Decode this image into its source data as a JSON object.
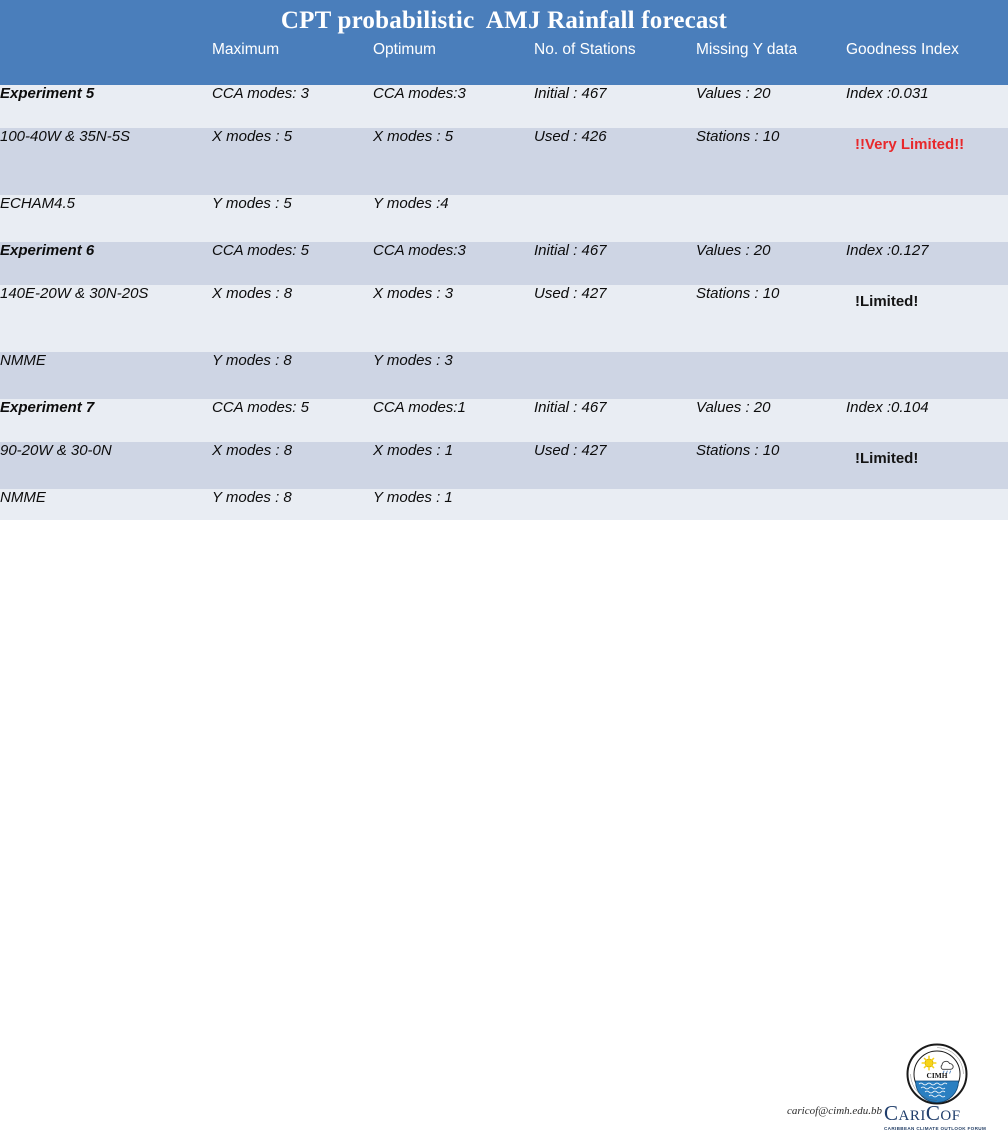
{
  "title": "CPT probabilistic  AMJ Rainfall forecast",
  "columns": [
    {
      "key": "label",
      "label": ""
    },
    {
      "key": "maximum",
      "label": "Maximum"
    },
    {
      "key": "optimum",
      "label": "Optimum"
    },
    {
      "key": "stations",
      "label": "No. of Stations"
    },
    {
      "key": "missing",
      "label": "Missing Y data"
    },
    {
      "key": "goodness",
      "label": "Goodness Index"
    }
  ],
  "blocks": [
    {
      "id": "experiment-5",
      "rows": [
        {
          "label": "Experiment 5",
          "maximum": "CCA modes: 3",
          "optimum": "CCA modes:3",
          "stations": "Initial : 467",
          "missing": "Values : 20"
        },
        {
          "label": "100-40W & 35N-5S",
          "maximum": "X modes : 5",
          "optimum": "X modes : 5",
          "stations": "Used : 426",
          "missing": "Stations : 10"
        },
        {
          "label": "ECHAM4.5",
          "maximum": "Y modes : 5",
          "optimum": "Y modes :4",
          "stations": "",
          "missing": ""
        }
      ],
      "goodness_index": "Index :0.031",
      "goodness_note": "!!Very Limited!!",
      "goodness_note_color": "#e8282b",
      "goodness_note_anchor": "bottom"
    },
    {
      "id": "experiment-6",
      "rows": [
        {
          "label": "Experiment 6",
          "maximum": "CCA modes: 5",
          "optimum": "CCA modes:3",
          "stations": "Initial : 467",
          "missing": "Values : 20"
        },
        {
          "label": "140E-20W & 30N-20S",
          "maximum": "X modes : 8",
          "optimum": "X modes : 3",
          "stations": "Used : 427",
          "missing": "Stations : 10"
        },
        {
          "label": "NMME",
          "maximum": "Y modes : 8",
          "optimum": "Y modes : 3",
          "stations": "",
          "missing": ""
        }
      ],
      "goodness_index": "Index :0.127",
      "goodness_note": "!Limited!",
      "goodness_note_color": "#141414",
      "goodness_note_anchor": "bottom"
    },
    {
      "id": "experiment-7",
      "rows": [
        {
          "label": "Experiment 7",
          "maximum": "CCA modes: 5",
          "optimum": "CCA modes:1",
          "stations": "Initial : 467",
          "missing": "Values : 20"
        },
        {
          "label": "90-20W & 30-0N",
          "maximum": "X modes : 8",
          "optimum": "X modes : 1",
          "stations": "Used : 427",
          "missing": "Stations : 10"
        },
        {
          "label": "NMME",
          "maximum": "Y modes : 8",
          "optimum": "Y modes : 1",
          "stations": "",
          "missing": ""
        }
      ],
      "goodness_index": "Index :0.104",
      "goodness_note": "!Limited!",
      "goodness_note_color": "#141414",
      "goodness_note_anchor": "top"
    }
  ],
  "footer": {
    "email": "caricof@cimh.edu.bb",
    "seal_text": "CIMH",
    "brand_cari": "C",
    "brand_cari_rest": "ARI",
    "brand_cof": "C",
    "brand_cof_rest": "OF",
    "brand_tagline": "CARIBBEAN CLIMATE OUTLOOK FORUM"
  },
  "colors": {
    "header_blue": "#4a7ebb",
    "row_light": "#e9edf3",
    "row_dark": "#ced5e4",
    "alert_red": "#e8282b"
  }
}
